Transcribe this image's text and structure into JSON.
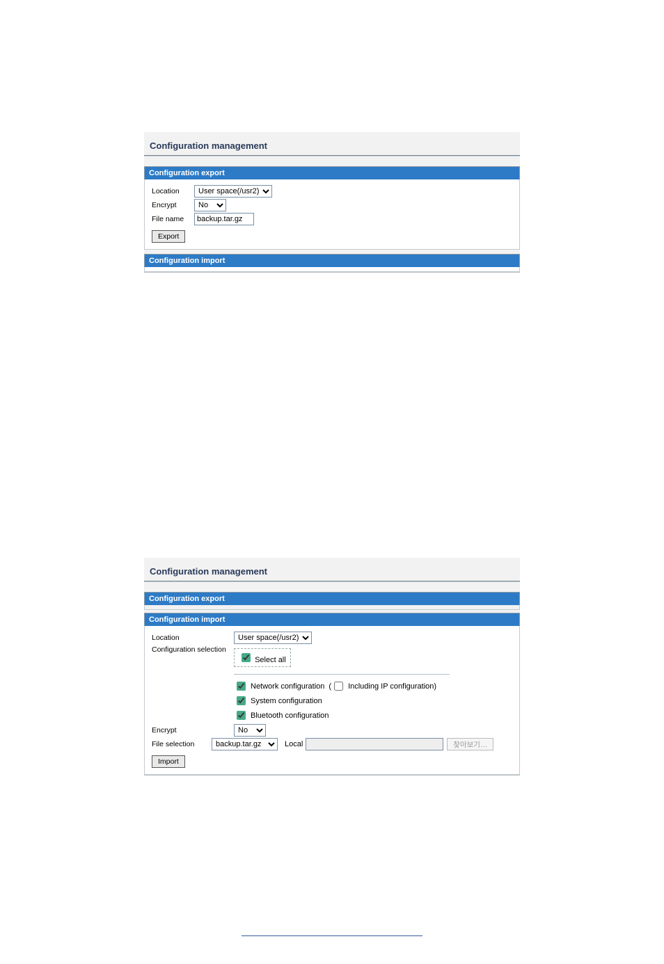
{
  "panel1": {
    "title": "Configuration management",
    "export": {
      "header": "Configuration export",
      "location_label": "Location",
      "location_value": "User space(/usr2)",
      "encrypt_label": "Encrypt",
      "encrypt_value": "No",
      "filename_label": "File name",
      "filename_value": "backup.tar.gz",
      "export_btn": "Export"
    },
    "import": {
      "header": "Configuration import"
    }
  },
  "panel2": {
    "title": "Configuration management",
    "export": {
      "header": "Configuration export"
    },
    "import": {
      "header": "Configuration import",
      "location_label": "Location",
      "location_value": "User space(/usr2)",
      "config_sel_label": "Configuration selection",
      "select_all": "Select all",
      "net_label": "Network configuration",
      "net_ip_label": "Including IP configuration",
      "sys_label": "System configuration",
      "bt_label": "Bluetooth configuration",
      "encrypt_label": "Encrypt",
      "encrypt_value": "No",
      "filesel_label": "File selection",
      "filesel_value": "backup.tar.gz",
      "local_label": "Local",
      "browse_btn": "찾아보기…",
      "import_btn": "Import"
    }
  }
}
